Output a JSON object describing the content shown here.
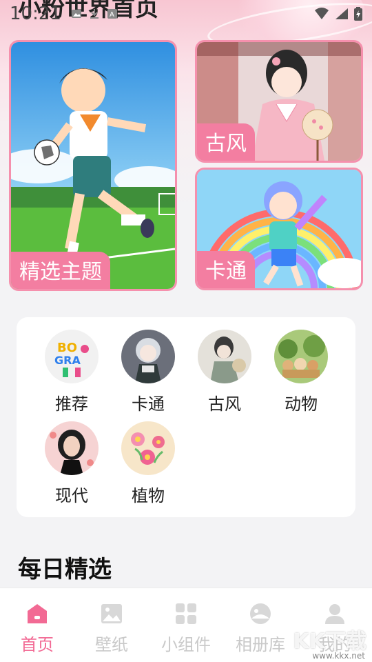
{
  "status_bar": {
    "time": "10:21"
  },
  "header": {
    "title": "小粉世界首页"
  },
  "feature_cards": {
    "featured": {
      "label": "精选主题"
    },
    "ancient": {
      "label": "古风"
    },
    "cartoon": {
      "label": "卡通"
    }
  },
  "categories": [
    {
      "label": "推荐",
      "icon": "graffiti-art-icon"
    },
    {
      "label": "卡通",
      "icon": "cartoon-girl-icon"
    },
    {
      "label": "古风",
      "icon": "ancient-style-girl-icon"
    },
    {
      "label": "动物",
      "icon": "animals-icon"
    },
    {
      "label": "现代",
      "icon": "modern-woman-icon"
    },
    {
      "label": "植物",
      "icon": "flowers-icon"
    }
  ],
  "section": {
    "title": "每日精选"
  },
  "bottom_nav": [
    {
      "label": "首页",
      "icon": "home-icon",
      "active": true
    },
    {
      "label": "壁纸",
      "icon": "image-icon",
      "active": false
    },
    {
      "label": "小组件",
      "icon": "widgets-grid-icon",
      "active": false
    },
    {
      "label": "相册库",
      "icon": "album-icon",
      "active": false
    },
    {
      "label": "我的",
      "icon": "user-icon",
      "active": false
    }
  ],
  "watermark": {
    "text": "KK下载",
    "url": "www.kkx.net"
  },
  "colors": {
    "accent": "#f26a94",
    "card_border": "#f590ad",
    "label_bg": "#f37ea1"
  }
}
